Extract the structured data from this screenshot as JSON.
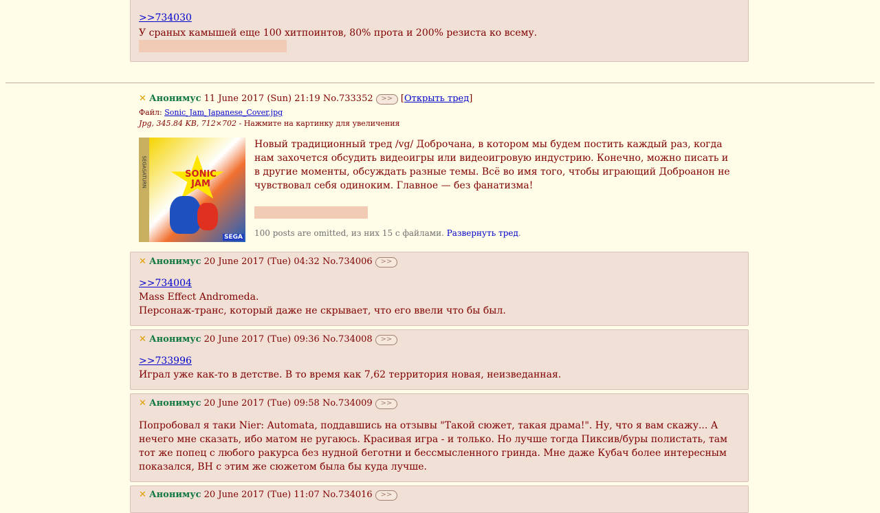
{
  "top_post": {
    "quote": ">>734030",
    "text": "У сраных камышей еще 100 хитпоинтов, 80% прота и 200% резиста ко всему."
  },
  "op": {
    "mark": "✕",
    "name": "Анонимус",
    "date": "11 June 2017 (Sun) 21:19",
    "number": "No.733352",
    "reply_btn": ">>",
    "open_bracket_l": "[",
    "open_thread": "Открыть тред",
    "open_bracket_r": "]",
    "file_label": "Файл:",
    "file_name": "Sonic_Jam_Japanese_Cover.jpg",
    "file_meta": "Jpg, 345.84 KB, 712×702",
    "file_hint": " - Нажмите на картинку для увеличения",
    "image_title": "SONIC JAM",
    "image_brand": "SEGA",
    "image_side": "SEGASATURN",
    "text": "Новый традиционный тред /vg/ Доброчана, в котором мы будем постить каждый раз, когда нам захочется обсудить видеоигры или видеоигровую индустрию. Конечно, можно писать и в другие моменты, обсуждать разные темы. Всё во имя того, чтобы играющий Доброанон не чувствовал себя одиноким. Главное — без фанатизма!",
    "omitted": "100 posts are omitted, из них 15 с файлами.",
    "expand": "Развернуть тред"
  },
  "replies": [
    {
      "mark": "✕",
      "name": "Анонимус",
      "date": "20 June 2017 (Tue) 04:32",
      "number": "No.734006",
      "btn": ">>",
      "quote": ">>734004",
      "line1": "Mass Effect Andromeda.",
      "line2": "Персонаж-транс, который даже не скрывает, что его ввели что бы был."
    },
    {
      "mark": "✕",
      "name": "Анонимус",
      "date": "20 June 2017 (Tue) 09:36",
      "number": "No.734008",
      "btn": ">>",
      "quote": ">>733996",
      "line1": "Играл уже как-то в детстве. В то время как 7,62 территория новая, неизведанная."
    },
    {
      "mark": "✕",
      "name": "Анонимус",
      "date": "20 June 2017 (Tue) 09:58",
      "number": "No.734009",
      "btn": ">>",
      "text": "Попробовал я таки Nier: Automata, поддавшись на отзывы \"Такой сюжет, такая драма!\". Ну, что я вам скажу... А нечего мне сказать, ибо матом не ругаюсь. Красивая игра - и только. Но лучше тогда Пиксив/буры полистать, там тот же попец с любого ракурса без нудной беготни и бессмысленного гринда. Мне даже Кубач более интересным показался, ВН с этим же сюжетом была бы куда лучше."
    },
    {
      "mark": "✕",
      "name": "Анонимус",
      "date": "20 June 2017 (Tue) 11:07",
      "number": "No.734016",
      "btn": ">>"
    }
  ]
}
